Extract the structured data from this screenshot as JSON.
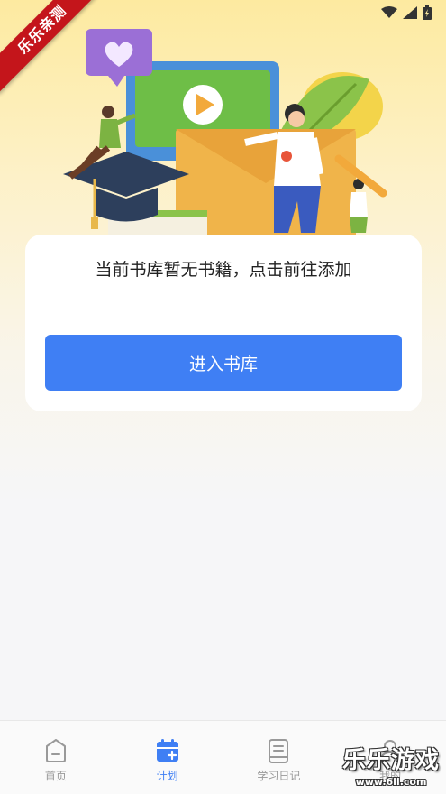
{
  "watermark_top": "乐乐亲测",
  "card": {
    "empty_message": "当前书库暂无书籍，点击前往添加",
    "enter_button_label": "进入书库"
  },
  "tabbar": {
    "tabs": [
      {
        "label": "首页",
        "icon": "home-icon",
        "active": false
      },
      {
        "label": "计划",
        "icon": "calendar-plus-icon",
        "active": true
      },
      {
        "label": "学习日记",
        "icon": "notebook-icon",
        "active": false
      },
      {
        "label": "我的",
        "icon": "profile-icon",
        "active": false
      }
    ]
  },
  "watermark_bottom": {
    "title": "乐乐游戏",
    "url": "www.6ll.com"
  },
  "colors": {
    "accent": "#3f7ff4",
    "inactive": "#999999",
    "ribbon": "#c4151b"
  }
}
